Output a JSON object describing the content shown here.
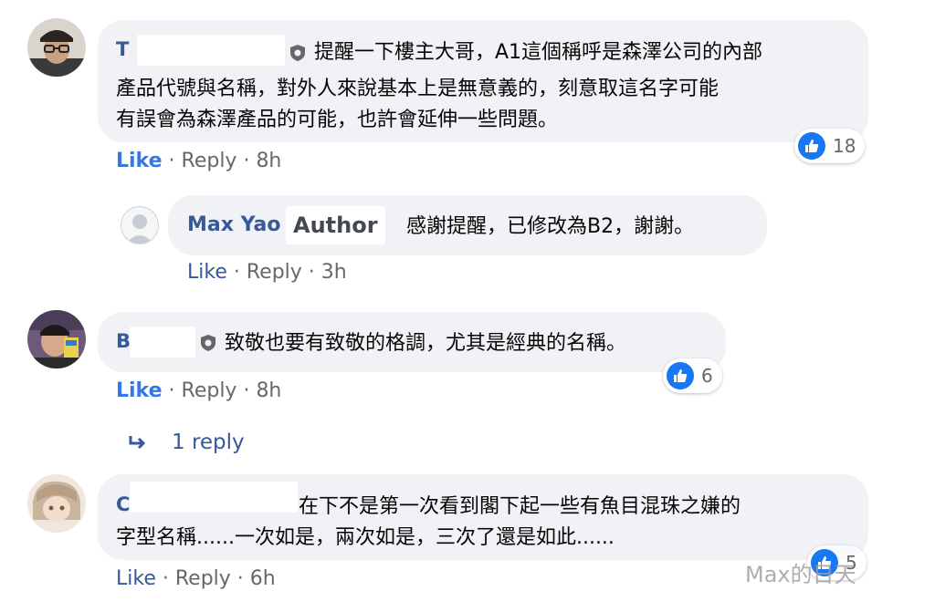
{
  "comments": [
    {
      "name": "T",
      "text_line1": "提醒一下樓主大哥，A1這個稱呼是森澤公司的內部",
      "text_line2": "產品代號與名稱，對外人來說基本上是無意義的，刻意取這名字可能",
      "text_line3": "有誤會為森澤產品的可能，也許會延伸一些問題。",
      "like": "Like",
      "reply": "Reply",
      "time": "8h",
      "reaction_count": "18"
    },
    {
      "name": "Max Yao",
      "badge": "Author",
      "text_line1": "感謝提醒，已修改為B2，謝謝。",
      "like": "Like",
      "reply": "Reply",
      "time": "3h"
    },
    {
      "name": "B",
      "text_line1": "致敬也要有致敬的格調，尤其是經典的名稱。",
      "like": "Like",
      "reply": "Reply",
      "time": "8h",
      "reaction_count": "6",
      "replies_label": "1 reply"
    },
    {
      "name": "C",
      "text_line1": "在下不是第一次看到閣下起一些有魚目混珠之嫌的",
      "text_line2": "字型名稱......一次如是，兩次如是，三次了還是如此......",
      "like": "Like",
      "reply": "Reply",
      "time": "6h",
      "reaction_count": "5"
    }
  ],
  "separator": " · ",
  "watermark": "Max的日天",
  "icons": {
    "moderator": "shield-icon",
    "reaction": "thumbs-up-icon",
    "reply_arrow": "reply-arrow-icon"
  },
  "colors": {
    "bubble": "#f0f2f5",
    "name": "#385898",
    "like_blue": "#1877f2",
    "meta": "#65676b"
  }
}
